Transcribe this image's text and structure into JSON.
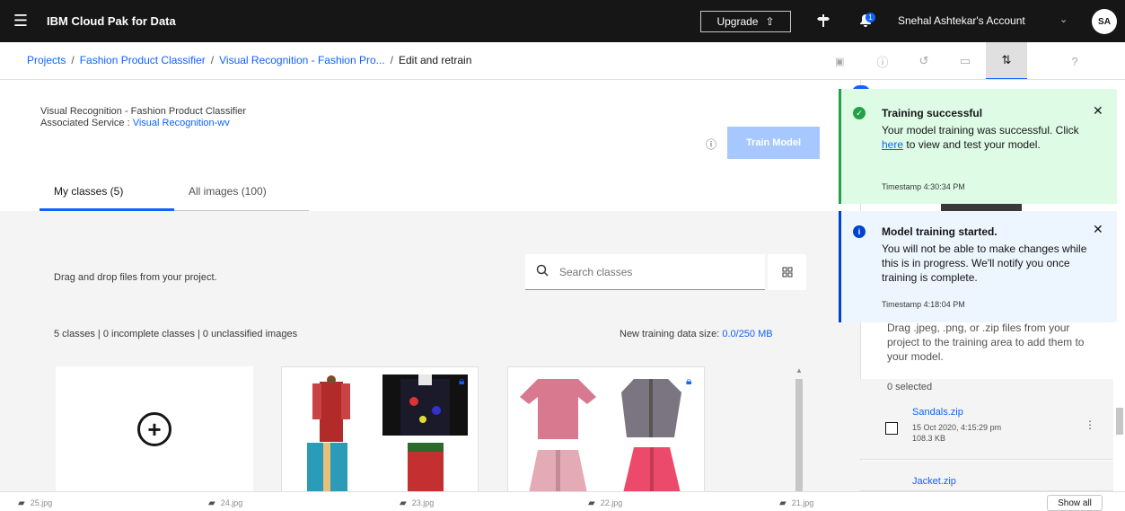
{
  "topbar": {
    "brand": "IBM Cloud Pak for Data",
    "upgrade_label": "Upgrade",
    "notification_count": "1",
    "account": "Snehal Ashtekar's Account",
    "avatar_initials": "SA"
  },
  "breadcrumb": {
    "items": [
      "Projects",
      "Fashion Product Classifier",
      "Visual Recognition - Fashion Pro..."
    ],
    "current": "Edit and retrain",
    "separator": "/"
  },
  "header": {
    "model_name": "Visual Recognition - Fashion Product Classifier",
    "assoc_label": "Associated Service :",
    "assoc_service": "Visual Recognition-wv",
    "train_button": "Train Model"
  },
  "tabs": [
    {
      "label": "My classes (5)",
      "active": true
    },
    {
      "label": "All images (100)",
      "active": false
    }
  ],
  "workarea": {
    "drag_text": "Drag and drop files from your project.",
    "search_placeholder": "Search classes",
    "stats": "5 classes | 0 incomplete classes | 0 unclassified images",
    "datasize_label": "New training data size:",
    "datasize_value": "0.0/250 MB"
  },
  "right_panel": {
    "drag_text": "Drag .jpeg, .png, or .zip files from your project to the training area to add them to your model.",
    "selected": "0 selected",
    "files": [
      {
        "name": "Sandals.zip",
        "date": "15 Oct 2020, 4:15:29 pm",
        "size": "108.3 KB"
      },
      {
        "name": "Jacket.zip",
        "date": "",
        "size": ""
      }
    ]
  },
  "toasts": [
    {
      "kind": "success",
      "title": "Training successful",
      "body_before": "Your model training was successful. Click",
      "body_link": "here",
      "body_after": "to view and test your model.",
      "timestamp": "Timestamp 4:30:34 PM"
    },
    {
      "kind": "info",
      "title": "Model training started.",
      "body": "You will not be able to make changes while this is in progress. We'll notify you once training is complete.",
      "timestamp": "Timestamp 4:18:04 PM"
    }
  ],
  "bottombar": {
    "downloads": [
      "25.jpg",
      "24.jpg",
      "23.jpg",
      "22.jpg",
      "21.jpg"
    ],
    "show_all": "Show all"
  },
  "colors": {
    "accent": "#0f62fe",
    "topbar": "#161616",
    "success": "#24a148",
    "info": "#0043ce",
    "train_disabled": "#a6c8ff"
  },
  "icons": [
    "hamburger-icon",
    "upgrade-arrow-icon",
    "signpost-icon",
    "notification-icon",
    "chevron-down-icon",
    "info-icon",
    "search-icon",
    "grid-icon",
    "add-circle-icon",
    "lock-icon",
    "close-icon",
    "checkmark-icon",
    "overflow-menu-icon"
  ]
}
